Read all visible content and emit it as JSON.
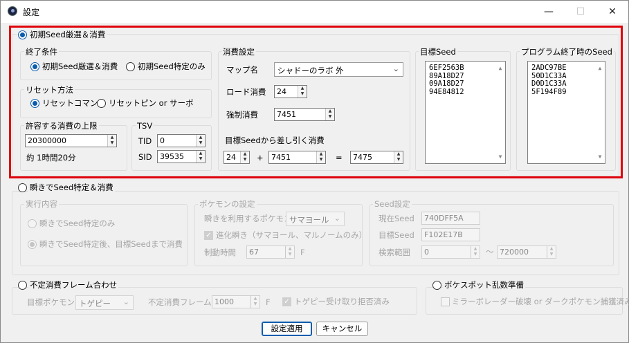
{
  "window": {
    "title": "設定",
    "minimize": "—",
    "maximize": "☐",
    "close": "✕"
  },
  "section1": {
    "title": "初期Seed厳選＆消費",
    "end_condition": {
      "title": "終了条件",
      "opt1": "初期Seed厳選＆消費",
      "opt2": "初期Seed特定のみ"
    },
    "reset_method": {
      "title": "リセット方法",
      "opt1": "リセットコマンド",
      "opt2": "リセットピン or サーボ"
    },
    "limit": {
      "title": "許容する消費の上限",
      "value": "20300000",
      "estimate": "約 1時間20分"
    },
    "tsv": {
      "title": "TSV",
      "tid_label": "TID",
      "tid": "0",
      "sid_label": "SID",
      "sid": "39535"
    },
    "consume": {
      "title": "消費設定",
      "map_label": "マップ名",
      "map_value": "シャドーのラボ 外",
      "load_label": "ロード消費",
      "load_value": "24",
      "force_label": "強制消費",
      "force_value": "7451",
      "subtract_label": "目標Seedから差し引く消費",
      "sub_a": "24",
      "plus": "+",
      "sub_b": "7451",
      "equals": "=",
      "sub_result": "7475"
    },
    "target_seed": {
      "title": "目標Seed",
      "values": [
        "6EF2563B",
        "89A18D27",
        "09A18D27",
        "94E84812"
      ]
    },
    "end_seed": {
      "title": "プログラム終了時のSeed",
      "values": [
        "2ADC97BE",
        "50D1C33A",
        "D0D1C33A",
        "5F194F89"
      ]
    }
  },
  "section2": {
    "title": "瞬きでSeed特定＆消費",
    "exec": {
      "title": "実行内容",
      "opt1": "瞬きでSeed特定のみ",
      "opt2": "瞬きでSeed特定後、目標Seedまで消費"
    },
    "pokemon": {
      "title": "ポケモンの設定",
      "blink_label": "瞬きを利用するポケモン",
      "blink_value": "サマヨール",
      "evolve": "進化瞬き（サマヨール、マルノームのみ）",
      "ctrl_label": "制動時間",
      "ctrl_value": "67",
      "ctrl_unit": "F"
    },
    "seed": {
      "title": "Seed設定",
      "current_label": "現在Seed",
      "current": "740DFF5A",
      "target_label": "目標Seed",
      "target": "F102E17B",
      "range_label": "検索範囲",
      "range_from": "0",
      "tilde": "〜",
      "range_to": "720000"
    }
  },
  "section3": {
    "title": "不定消費フレーム合わせ",
    "target_label": "目標ポケモン",
    "target_value": "トゲピー",
    "frame_label": "不定消費フレーム",
    "frame_value": "1000",
    "frame_unit": "F",
    "togepi": "トゲピー受け取り拒否済み"
  },
  "section4": {
    "title": "ポケスポット乱数準備",
    "mirror": "ミラーボレーダー破壊 or ダークポケモン捕獲済み"
  },
  "buttons": {
    "apply": "設定適用",
    "cancel": "キャンセル"
  },
  "colors": {
    "highlight": "#e0000a",
    "accent": "#0b5cad"
  }
}
